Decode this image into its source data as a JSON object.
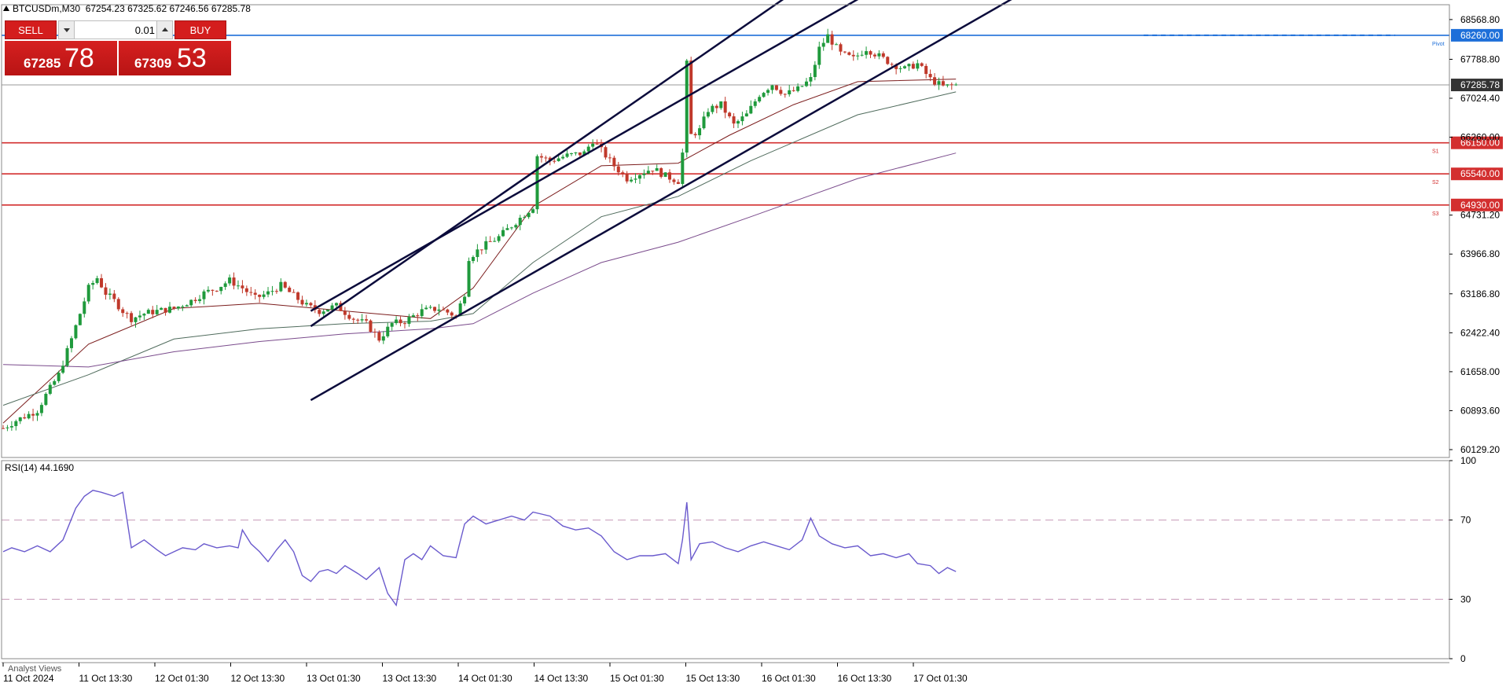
{
  "header": {
    "symbol": "BTCUSDm,M30",
    "ohlc": "67254.23 67325.62 67246.56 67285.78"
  },
  "trade_panel": {
    "sell_label": "SELL",
    "buy_label": "BUY",
    "lot": "0.01",
    "sell_price_small": "67285",
    "sell_price_big": "78",
    "buy_price_small": "67309",
    "buy_price_big": "53"
  },
  "rsi": {
    "label": "RSI(14) 44.1690"
  },
  "footer": {
    "analyst_label": "Analyst Views"
  },
  "colors": {
    "bull": "#1f9a3c",
    "bear": "#c0392b",
    "channel": "#0b0b3b",
    "pivot": "#1e6fd9",
    "support": "#d32f2f",
    "ma_fast": "#7b1c1c",
    "ma_mid": "#4f6b5c",
    "ma_slow": "#7a4b8c",
    "rsi_line": "#6a5acd",
    "current": "#333333"
  },
  "chart_data": [
    {
      "type": "candlestick",
      "series_name": "BTCUSDm, M30",
      "y_ticks": [
        "68568.80",
        "67788.80",
        "67024.40",
        "66260.00",
        "64731.20",
        "63966.80",
        "63186.80",
        "62422.40",
        "61658.00",
        "60893.60",
        "60129.20"
      ],
      "y_range": [
        59975,
        68860
      ],
      "x_ticks": [
        "11 Oct 2024",
        "11 Oct 13:30",
        "12 Oct 01:30",
        "12 Oct 13:30",
        "13 Oct 01:30",
        "13 Oct 13:30",
        "14 Oct 01:30",
        "14 Oct 13:30",
        "15 Oct 01:30",
        "15 Oct 13:30",
        "16 Oct 01:30",
        "16 Oct 13:30",
        "17 Oct 01:30"
      ],
      "current_price": "67285.78",
      "levels": [
        {
          "name": "Pivot",
          "price": 68260.0,
          "label": "68260.00"
        },
        {
          "name": "S1",
          "price": 66150.0,
          "label": "66150.00"
        },
        {
          "name": "S2",
          "price": 65540.0,
          "label": "65540.00"
        },
        {
          "name": "S3",
          "price": 64930.0,
          "label": "64930.00"
        }
      ],
      "close_path": [
        [
          0,
          60550
        ],
        [
          3,
          60700
        ],
        [
          8,
          60900
        ],
        [
          10,
          61200
        ],
        [
          13,
          61600
        ],
        [
          16,
          62300
        ],
        [
          18,
          62800
        ],
        [
          20,
          63300
        ],
        [
          22,
          63500
        ],
        [
          24,
          63200
        ],
        [
          26,
          63050
        ],
        [
          28,
          62850
        ],
        [
          30,
          62700
        ],
        [
          33,
          62800
        ],
        [
          36,
          62850
        ],
        [
          40,
          62900
        ],
        [
          44,
          63050
        ],
        [
          47,
          63200
        ],
        [
          50,
          63300
        ],
        [
          53,
          63450
        ],
        [
          56,
          63300
        ],
        [
          59,
          63100
        ],
        [
          62,
          63200
        ],
        [
          65,
          63350
        ],
        [
          68,
          63150
        ],
        [
          71,
          62950
        ],
        [
          74,
          62850
        ],
        [
          78,
          62950
        ],
        [
          82,
          62700
        ],
        [
          85,
          62600
        ],
        [
          88,
          62300
        ],
        [
          91,
          62600
        ],
        [
          94,
          62650
        ],
        [
          98,
          62850
        ],
        [
          102,
          62900
        ],
        [
          106,
          62750
        ],
        [
          108,
          63200
        ],
        [
          109,
          63900
        ],
        [
          112,
          64100
        ],
        [
          116,
          64300
        ],
        [
          120,
          64600
        ],
        [
          124,
          64900
        ],
        [
          125,
          65900
        ],
        [
          128,
          65800
        ],
        [
          132,
          65900
        ],
        [
          136,
          65950
        ],
        [
          138,
          66200
        ],
        [
          140,
          66000
        ],
        [
          143,
          65700
        ],
        [
          146,
          65450
        ],
        [
          149,
          65550
        ],
        [
          152,
          65650
        ],
        [
          155,
          65500
        ],
        [
          158,
          65400
        ],
        [
          159,
          65950
        ],
        [
          160,
          67700
        ],
        [
          161,
          66300
        ],
        [
          163,
          66400
        ],
        [
          165,
          66800
        ],
        [
          168,
          66900
        ],
        [
          171,
          66500
        ],
        [
          174,
          66700
        ],
        [
          177,
          67100
        ],
        [
          180,
          67300
        ],
        [
          183,
          67100
        ],
        [
          186,
          67200
        ],
        [
          189,
          67400
        ],
        [
          191,
          68000
        ],
        [
          193,
          68250
        ],
        [
          196,
          67900
        ],
        [
          199,
          67800
        ],
        [
          202,
          68000
        ],
        [
          205,
          67850
        ],
        [
          208,
          67700
        ],
        [
          211,
          67600
        ],
        [
          214,
          67700
        ],
        [
          217,
          67400
        ],
        [
          220,
          67250
        ],
        [
          223,
          67285
        ]
      ],
      "moving_averages": [
        {
          "name": "ma_fast",
          "values": [
            [
              0,
              60650
            ],
            [
              20,
              62200
            ],
            [
              40,
              62900
            ],
            [
              60,
              63000
            ],
            [
              80,
              62850
            ],
            [
              100,
              62700
            ],
            [
              110,
              63300
            ],
            [
              124,
              64900
            ],
            [
              140,
              65700
            ],
            [
              158,
              65750
            ],
            [
              170,
              66300
            ],
            [
              185,
              66900
            ],
            [
              200,
              67350
            ],
            [
              223,
              67400
            ]
          ]
        },
        {
          "name": "ma_mid",
          "values": [
            [
              0,
              61000
            ],
            [
              20,
              61600
            ],
            [
              40,
              62300
            ],
            [
              60,
              62500
            ],
            [
              80,
              62600
            ],
            [
              100,
              62650
            ],
            [
              110,
              62800
            ],
            [
              124,
              63800
            ],
            [
              140,
              64700
            ],
            [
              158,
              65100
            ],
            [
              175,
              65800
            ],
            [
              200,
              66700
            ],
            [
              223,
              67150
            ]
          ]
        },
        {
          "name": "ma_slow",
          "values": [
            [
              0,
              61800
            ],
            [
              20,
              61750
            ],
            [
              40,
              62050
            ],
            [
              60,
              62250
            ],
            [
              80,
              62400
            ],
            [
              100,
              62500
            ],
            [
              110,
              62600
            ],
            [
              124,
              63200
            ],
            [
              140,
              63800
            ],
            [
              158,
              64200
            ],
            [
              175,
              64700
            ],
            [
              200,
              65450
            ],
            [
              223,
              65950
            ]
          ]
        }
      ],
      "channel_lines": [
        {
          "name": "upper",
          "from": [
            72,
            62550
          ],
          "to": [
            190,
            69400
          ]
        },
        {
          "name": "middle",
          "from": [
            72,
            62850
          ],
          "to": [
            230,
            70400
          ]
        },
        {
          "name": "lower",
          "from": [
            72,
            61100
          ],
          "to": [
            270,
            70600
          ]
        }
      ]
    },
    {
      "type": "line",
      "series_name": "RSI(14)",
      "y_ticks": [
        "100",
        "70",
        "30",
        "0"
      ],
      "y_range": [
        0,
        100
      ],
      "levels": [
        70,
        30
      ],
      "values": [
        [
          0,
          54
        ],
        [
          2,
          56
        ],
        [
          5,
          54
        ],
        [
          8,
          57
        ],
        [
          11,
          54
        ],
        [
          14,
          60
        ],
        [
          17,
          76
        ],
        [
          19,
          82
        ],
        [
          21,
          85
        ],
        [
          23,
          84
        ],
        [
          26,
          82
        ],
        [
          28,
          84
        ],
        [
          30,
          56
        ],
        [
          33,
          60
        ],
        [
          36,
          55
        ],
        [
          38,
          52
        ],
        [
          40,
          54
        ],
        [
          42,
          56
        ],
        [
          45,
          55
        ],
        [
          47,
          58
        ],
        [
          50,
          56
        ],
        [
          53,
          57
        ],
        [
          55,
          56
        ],
        [
          56,
          65
        ],
        [
          58,
          58
        ],
        [
          60,
          54
        ],
        [
          62,
          49
        ],
        [
          64,
          55
        ],
        [
          66,
          60
        ],
        [
          68,
          54
        ],
        [
          70,
          42
        ],
        [
          72,
          39
        ],
        [
          74,
          44
        ],
        [
          76,
          45
        ],
        [
          78,
          43
        ],
        [
          80,
          47
        ],
        [
          83,
          43
        ],
        [
          85,
          40
        ],
        [
          88,
          46
        ],
        [
          90,
          33
        ],
        [
          92,
          27
        ],
        [
          94,
          50
        ],
        [
          96,
          53
        ],
        [
          98,
          50
        ],
        [
          100,
          57
        ],
        [
          103,
          52
        ],
        [
          106,
          51
        ],
        [
          108,
          68
        ],
        [
          110,
          72
        ],
        [
          113,
          68
        ],
        [
          116,
          70
        ],
        [
          119,
          72
        ],
        [
          122,
          70
        ],
        [
          124,
          74
        ],
        [
          126,
          73
        ],
        [
          128,
          72
        ],
        [
          131,
          67
        ],
        [
          134,
          65
        ],
        [
          137,
          66
        ],
        [
          140,
          62
        ],
        [
          143,
          54
        ],
        [
          146,
          50
        ],
        [
          149,
          52
        ],
        [
          152,
          52
        ],
        [
          155,
          53
        ],
        [
          158,
          48
        ],
        [
          159,
          60
        ],
        [
          160,
          79
        ],
        [
          161,
          50
        ],
        [
          163,
          58
        ],
        [
          166,
          59
        ],
        [
          169,
          56
        ],
        [
          172,
          54
        ],
        [
          175,
          57
        ],
        [
          178,
          59
        ],
        [
          181,
          57
        ],
        [
          184,
          55
        ],
        [
          187,
          60
        ],
        [
          189,
          71
        ],
        [
          191,
          62
        ],
        [
          194,
          58
        ],
        [
          197,
          56
        ],
        [
          200,
          57
        ],
        [
          203,
          52
        ],
        [
          206,
          53
        ],
        [
          209,
          51
        ],
        [
          212,
          53
        ],
        [
          214,
          48
        ],
        [
          217,
          47
        ],
        [
          219,
          43
        ],
        [
          221,
          46
        ],
        [
          223,
          44
        ]
      ]
    }
  ]
}
